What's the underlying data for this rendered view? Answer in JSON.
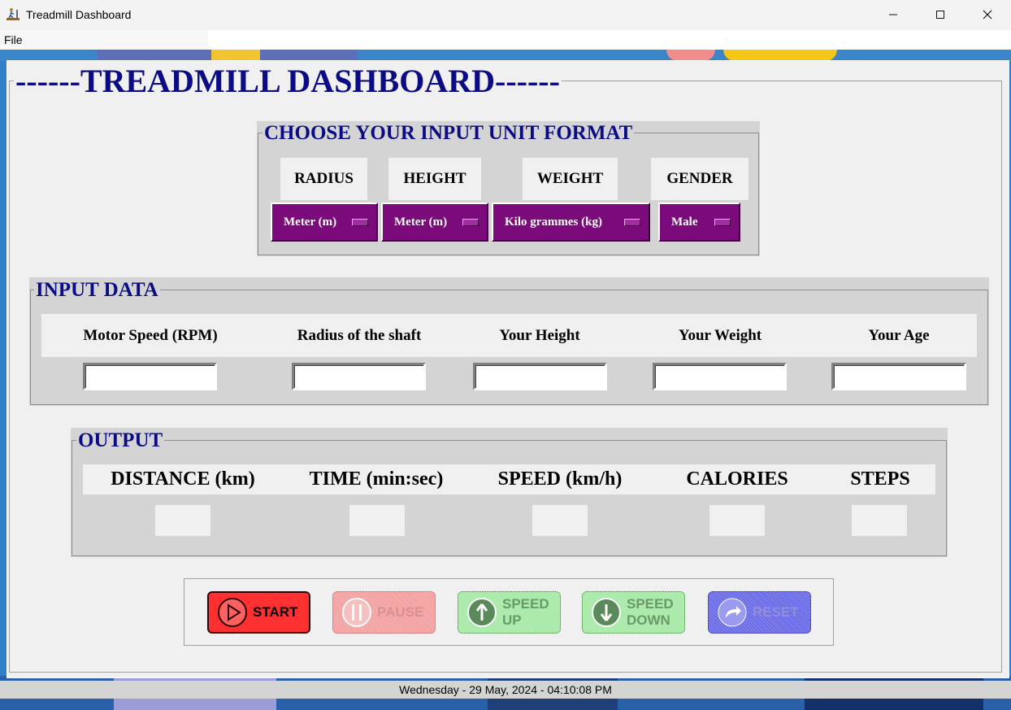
{
  "window": {
    "title": "Treadmill Dashboard",
    "minimize_icon": "minimize-icon",
    "maximize_icon": "maximize-icon",
    "close_icon": "close-icon"
  },
  "menu": {
    "file": "File"
  },
  "main": {
    "title": "------TREADMILL DASHBOARD------"
  },
  "unit_format": {
    "title": "CHOOSE YOUR INPUT UNIT FORMAT",
    "headers": [
      "RADIUS",
      "HEIGHT",
      "WEIGHT",
      "GENDER"
    ],
    "menus": [
      "Meter (m)",
      "Meter (m)",
      "Kilo grammes (kg)",
      "Male"
    ]
  },
  "input_data": {
    "title": "INPUT DATA",
    "headers": [
      "Motor Speed (RPM)",
      "Radius of the shaft",
      "Your Height",
      "Your Weight",
      "Your Age"
    ],
    "values": [
      "",
      "",
      "",
      "",
      ""
    ]
  },
  "output": {
    "title": "OUTPUT",
    "headers": [
      "DISTANCE (km)",
      "TIME (min:sec)",
      "SPEED (km/h)",
      "CALORIES",
      "STEPS"
    ],
    "values": [
      "",
      "",
      "",
      "",
      ""
    ]
  },
  "controls": {
    "start": "START",
    "pause": "PAUSE",
    "speed_up": [
      "SPEED",
      "UP"
    ],
    "speed_down": [
      "SPEED",
      "DOWN"
    ],
    "reset": "RESET"
  },
  "colors": {
    "title_blue": "#0b0b85",
    "option_purple": "#7b0a7b",
    "start_red": "#ff3030",
    "pause_pink": "#f3a1a1",
    "speed_green": "#a7e9a7",
    "reset_blue": "#6c6ce8",
    "group_gray": "#d4d4d4"
  },
  "status": {
    "datetime": "Wednesday - 29 May, 2024 - 04:10:08 PM"
  }
}
